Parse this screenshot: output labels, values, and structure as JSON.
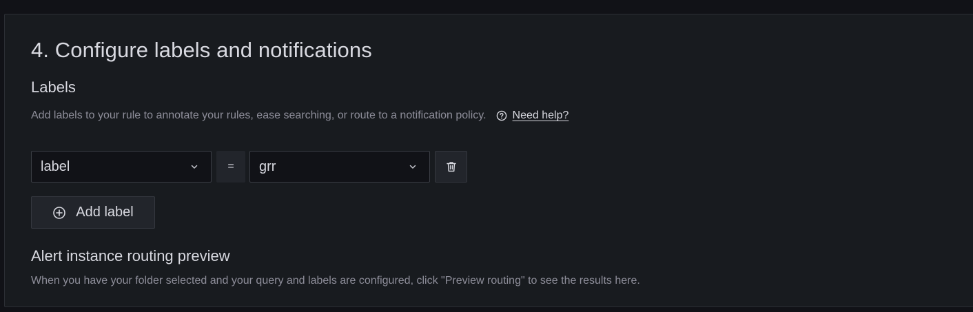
{
  "section": {
    "title": "4. Configure labels and notifications"
  },
  "labels": {
    "heading": "Labels",
    "description": "Add labels to your rule to annotate your rules, ease searching, or route to a notification policy.",
    "help_link": "Need help?",
    "help_icon": "question-circle-icon"
  },
  "label_row": {
    "key": "label",
    "operator": "=",
    "value": "grr",
    "dropdown_icon": "chevron-down-icon",
    "delete_icon": "trash-icon"
  },
  "add_label": {
    "label": "Add label",
    "icon": "plus-circle-icon"
  },
  "routing": {
    "heading": "Alert instance routing preview",
    "description": "When you have your folder selected and your query and labels are configured, click \"Preview routing\" to see the results here."
  },
  "colors": {
    "background": "#111217",
    "panel": "#181b1f",
    "text_primary": "#d8d9e0",
    "text_secondary": "#8e8e9a"
  }
}
